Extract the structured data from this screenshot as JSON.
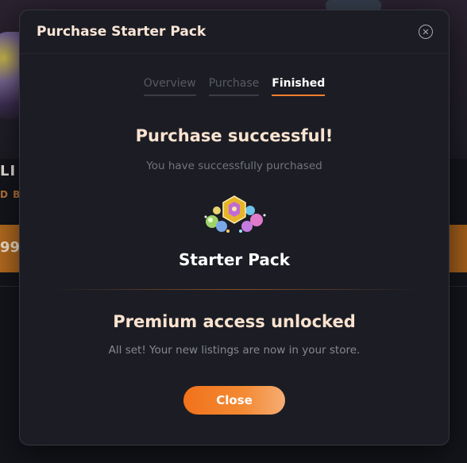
{
  "background": {
    "name_fragment": "LI",
    "tag_fragment": "D BO",
    "price_fragment": "99"
  },
  "modal": {
    "title": "Purchase Starter Pack",
    "tabs": [
      {
        "label": "Overview",
        "active": false
      },
      {
        "label": "Purchase",
        "active": false
      },
      {
        "label": "Finished",
        "active": true
      }
    ],
    "success_title": "Purchase successful!",
    "success_subtitle": "You have successfully purchased",
    "pack_name": "Starter Pack",
    "premium_title": "Premium access unlocked",
    "premium_subtitle": "All set! Your new listings are now in your store.",
    "close_button_label": "Close"
  },
  "colors": {
    "accent": "#f07f2a",
    "modal_bg": "#1c1d24",
    "heading": "#fbe3d0"
  },
  "icons": [
    "close-circle-icon",
    "starter-pack-art"
  ]
}
